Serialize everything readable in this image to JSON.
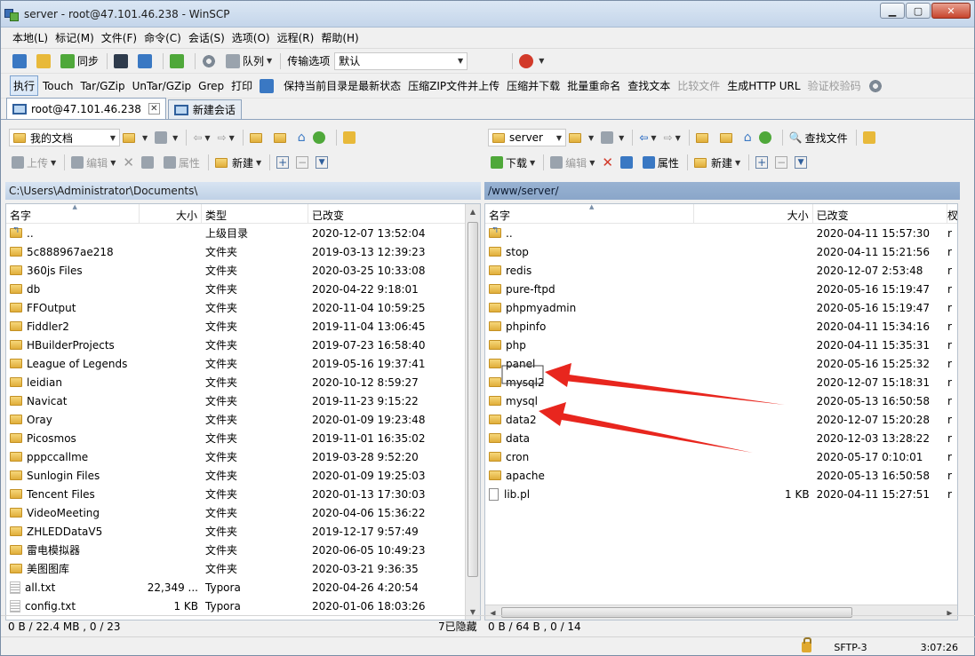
{
  "window": {
    "title": "server - root@47.101.46.238 - WinSCP"
  },
  "menu": [
    "本地(L)",
    "标记(M)",
    "文件(F)",
    "命令(C)",
    "会话(S)",
    "选项(O)",
    "远程(R)",
    "帮助(H)"
  ],
  "toolbar1": {
    "sync": "同步",
    "queue": "队列",
    "transfer_label": "传输选项",
    "transfer_value": "默认"
  },
  "toolbar2": {
    "execute": "执行",
    "touch": "Touch",
    "tar": "Tar/GZip",
    "untar": "UnTar/GZip",
    "grep": "Grep",
    "print": "打印",
    "keep_latest": "保持当前目录是最新状态",
    "zip_upload": "压缩ZIP文件并上传",
    "zip_download": "压缩并下载",
    "batch_rename": "批量重命名",
    "find_text": "查找文本",
    "compare_files": "比较文件",
    "gen_url": "生成HTTP URL",
    "verify_checksum": "验证校验码"
  },
  "tabs": {
    "session": "root@47.101.46.238",
    "new_session": "新建会话"
  },
  "left": {
    "location": "我的文档",
    "upload": "上传",
    "edit": "编辑",
    "properties": "属性",
    "new": "新建",
    "path": "C:\\Users\\Administrator\\Documents\\",
    "columns": {
      "name": "名字",
      "size": "大小",
      "type": "类型",
      "changed": "已改变"
    },
    "rows": [
      {
        "name": "..",
        "size": "",
        "type": "上级目录",
        "changed": "2020-12-07   13:52:04",
        "kind": "up"
      },
      {
        "name": "5c888967ae218",
        "size": "",
        "type": "文件夹",
        "changed": "2019-03-13   12:39:23",
        "kind": "folder"
      },
      {
        "name": "360js Files",
        "size": "",
        "type": "文件夹",
        "changed": "2020-03-25   10:33:08",
        "kind": "folder"
      },
      {
        "name": "db",
        "size": "",
        "type": "文件夹",
        "changed": "2020-04-22   9:18:01",
        "kind": "folder"
      },
      {
        "name": "FFOutput",
        "size": "",
        "type": "文件夹",
        "changed": "2020-11-04   10:59:25",
        "kind": "folder"
      },
      {
        "name": "Fiddler2",
        "size": "",
        "type": "文件夹",
        "changed": "2019-11-04   13:06:45",
        "kind": "folder"
      },
      {
        "name": "HBuilderProjects",
        "size": "",
        "type": "文件夹",
        "changed": "2019-07-23   16:58:40",
        "kind": "folder"
      },
      {
        "name": "League of Legends",
        "size": "",
        "type": "文件夹",
        "changed": "2019-05-16   19:37:41",
        "kind": "folder"
      },
      {
        "name": "leidian",
        "size": "",
        "type": "文件夹",
        "changed": "2020-10-12   8:59:27",
        "kind": "folder"
      },
      {
        "name": "Navicat",
        "size": "",
        "type": "文件夹",
        "changed": "2019-11-23   9:15:22",
        "kind": "folder"
      },
      {
        "name": "Oray",
        "size": "",
        "type": "文件夹",
        "changed": "2020-01-09   19:23:48",
        "kind": "folder"
      },
      {
        "name": "Picosmos",
        "size": "",
        "type": "文件夹",
        "changed": "2019-11-01   16:35:02",
        "kind": "folder"
      },
      {
        "name": "pppccallme",
        "size": "",
        "type": "文件夹",
        "changed": "2019-03-28   9:52:20",
        "kind": "folder"
      },
      {
        "name": "Sunlogin Files",
        "size": "",
        "type": "文件夹",
        "changed": "2020-01-09   19:25:03",
        "kind": "folder"
      },
      {
        "name": "Tencent Files",
        "size": "",
        "type": "文件夹",
        "changed": "2020-01-13   17:30:03",
        "kind": "folder"
      },
      {
        "name": "VideoMeeting",
        "size": "",
        "type": "文件夹",
        "changed": "2020-04-06   15:36:22",
        "kind": "folder"
      },
      {
        "name": "ZHLEDDataV5",
        "size": "",
        "type": "文件夹",
        "changed": "2019-12-17   9:57:49",
        "kind": "folder"
      },
      {
        "name": "雷电模拟器",
        "size": "",
        "type": "文件夹",
        "changed": "2020-06-05   10:49:23",
        "kind": "folder"
      },
      {
        "name": "美图图库",
        "size": "",
        "type": "文件夹",
        "changed": "2020-03-21   9:36:35",
        "kind": "folder"
      },
      {
        "name": "all.txt",
        "size": "22,349 ...",
        "type": "Typora",
        "changed": "2020-04-26   4:20:54",
        "kind": "text"
      },
      {
        "name": "config.txt",
        "size": "1 KB",
        "type": "Typora",
        "changed": "2020-01-06   18:03:26",
        "kind": "text"
      }
    ],
    "status": "0 B / 22.4 MB , 0 / 23",
    "hidden": "7已隐藏"
  },
  "right": {
    "location": "server",
    "download": "下载",
    "edit": "编辑",
    "properties": "属性",
    "new": "新建",
    "find_files": "查找文件",
    "path": "/www/server/",
    "columns": {
      "name": "名字",
      "size": "大小",
      "changed": "已改变",
      "extra": "杈"
    },
    "rows": [
      {
        "name": "..",
        "size": "",
        "changed": "2020-04-11 15:57:30",
        "extra": "r",
        "kind": "up"
      },
      {
        "name": "stop",
        "size": "",
        "changed": "2020-04-11 15:21:56",
        "extra": "r",
        "kind": "folder"
      },
      {
        "name": "redis",
        "size": "",
        "changed": "2020-12-07 2:53:48",
        "extra": "r",
        "kind": "folder"
      },
      {
        "name": "pure-ftpd",
        "size": "",
        "changed": "2020-05-16 15:19:47",
        "extra": "r",
        "kind": "folder"
      },
      {
        "name": "phpmyadmin",
        "size": "",
        "changed": "2020-05-16 15:19:47",
        "extra": "r",
        "kind": "folder"
      },
      {
        "name": "phpinfo",
        "size": "",
        "changed": "2020-04-11 15:34:16",
        "extra": "r",
        "kind": "folder"
      },
      {
        "name": "php",
        "size": "",
        "changed": "2020-04-11 15:35:31",
        "extra": "r",
        "kind": "folder"
      },
      {
        "name": "panel",
        "size": "",
        "changed": "2020-05-16 15:25:32",
        "extra": "r",
        "kind": "folder"
      },
      {
        "name": "mysql2",
        "size": "",
        "changed": "2020-12-07 15:18:31",
        "extra": "r",
        "kind": "folder"
      },
      {
        "name": "mysql",
        "size": "",
        "changed": "2020-05-13 16:50:58",
        "extra": "r",
        "kind": "folder"
      },
      {
        "name": "data2",
        "size": "",
        "changed": "2020-12-07 15:20:28",
        "extra": "r",
        "kind": "folder"
      },
      {
        "name": "data",
        "size": "",
        "changed": "2020-12-03 13:28:22",
        "extra": "r",
        "kind": "folder"
      },
      {
        "name": "cron",
        "size": "",
        "changed": "2020-05-17 0:10:01",
        "extra": "r",
        "kind": "folder"
      },
      {
        "name": "apache",
        "size": "",
        "changed": "2020-05-13 16:50:58",
        "extra": "r",
        "kind": "folder"
      },
      {
        "name": "lib.pl",
        "size": "1 KB",
        "changed": "2020-04-11 15:27:51",
        "extra": "r",
        "kind": "file"
      }
    ],
    "status": "0 B / 64 B , 0 / 14"
  },
  "bottom": {
    "protocol": "SFTP-3",
    "time": "3:07:26"
  },
  "colors": {
    "annotation": "#e8261e"
  }
}
